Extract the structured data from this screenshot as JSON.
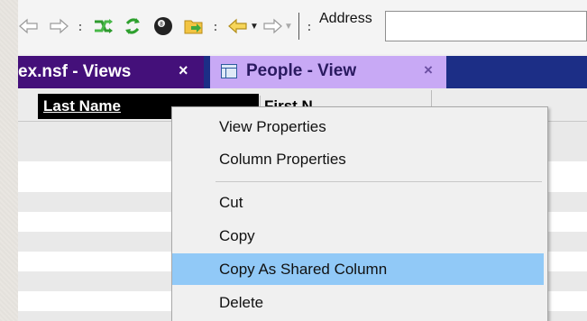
{
  "toolbar": {
    "separators": [
      ":",
      ":",
      ":"
    ],
    "address_label": "Address",
    "icons": [
      "back-arrow",
      "forward-arrow",
      "sync-green",
      "refresh-green",
      "eight-ball",
      "folder-arrow",
      "yellow-back-arrow",
      "dropdown-caret",
      "gray-forward-arrow",
      "dropdown-caret"
    ]
  },
  "tabs": [
    {
      "label": "ex.nsf - Views",
      "close": "×"
    },
    {
      "label": "People - View",
      "close": "×"
    }
  ],
  "columns": {
    "last_name": "Last Name",
    "first_name": "First N"
  },
  "menu": {
    "items": [
      {
        "label": "View Properties"
      },
      {
        "label": "Column Properties"
      },
      {
        "label": "Cut"
      },
      {
        "label": "Copy"
      },
      {
        "label": "Copy As Shared Column",
        "highlighted": true
      },
      {
        "label": "Delete"
      }
    ]
  },
  "colors": {
    "tab_active_bg": "#c8a9f5",
    "tab_inactive_bg": "#44107a",
    "tabstrip_bg": "#1c2e86",
    "menu_highlight": "#91c9f7"
  }
}
